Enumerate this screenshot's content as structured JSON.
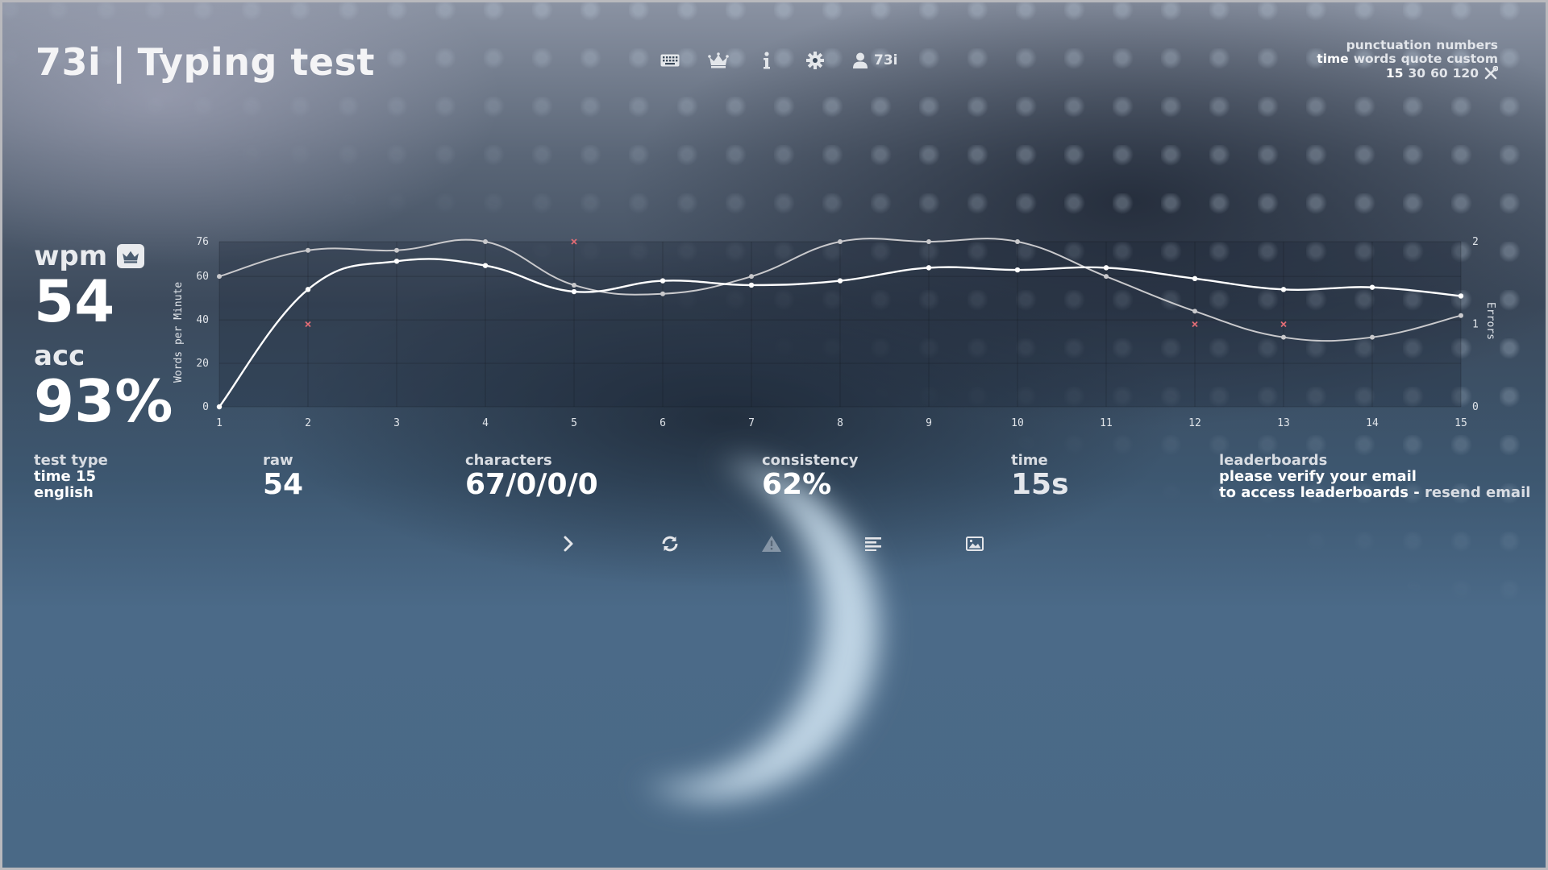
{
  "header": {
    "logo_user": "73i",
    "logo_sep": "|",
    "logo_title": "Typing test",
    "nav": [
      {
        "icon": "keyboard-icon"
      },
      {
        "icon": "crown-icon"
      },
      {
        "icon": "info-icon"
      },
      {
        "icon": "gear-icon"
      }
    ],
    "account_name": "73i"
  },
  "config": {
    "row1": [
      "punctuation",
      "numbers"
    ],
    "row2": [
      "time",
      "words",
      "quote",
      "custom"
    ],
    "row3": [
      "15",
      "30",
      "60",
      "120"
    ],
    "active_mode": "time",
    "active_time": "15",
    "tools_icon": "wrench-screwdriver-icon"
  },
  "result": {
    "wpm_label": "wpm",
    "wpm": "54",
    "acc_label": "acc",
    "acc": "93%"
  },
  "stats": {
    "test_type_label": "test type",
    "test_type_mode": "time 15",
    "test_type_lang": "english",
    "raw_label": "raw",
    "raw": "54",
    "characters_label": "characters",
    "characters": "67/0/0/0",
    "consistency_label": "consistency",
    "consistency": "62%",
    "time_label": "time",
    "time": "15s",
    "leaderboards_label": "leaderboards",
    "leaderboards_line1": "please verify your email",
    "leaderboards_line2_prefix": "to access leaderboards - ",
    "leaderboards_link": "resend email"
  },
  "actions": [
    {
      "name": "next-test-button",
      "icon": "chevron-right-icon"
    },
    {
      "name": "restart-button",
      "icon": "refresh-icon"
    },
    {
      "name": "report-button",
      "icon": "warning-icon"
    },
    {
      "name": "word-history-button",
      "icon": "list-icon"
    },
    {
      "name": "save-screenshot-button",
      "icon": "image-icon"
    }
  ],
  "colors": {
    "raw_line": "#c9c9cc",
    "wpm_line": "#ffffff",
    "error_mark": "#e06c75"
  },
  "chart_data": {
    "type": "line",
    "x": [
      1,
      2,
      3,
      4,
      5,
      6,
      7,
      8,
      9,
      10,
      11,
      12,
      13,
      14,
      15
    ],
    "xlabel": "",
    "ylabel": "Words per Minute",
    "y2label": "Errors",
    "ylim": [
      0,
      76
    ],
    "y_ticks": [
      0,
      20,
      40,
      60,
      76
    ],
    "y2lim": [
      0,
      2
    ],
    "y2_ticks": [
      0,
      1,
      2
    ],
    "series": [
      {
        "values": [
          60,
          72,
          72,
          76,
          56,
          52,
          60,
          76,
          76,
          76,
          60,
          44,
          32,
          32,
          42
        ]
      },
      {
        "values": [
          0,
          54,
          67,
          65,
          53,
          58,
          56,
          58,
          64,
          63,
          64,
          59,
          54,
          55,
          51
        ]
      },
      {
        "type": "scatter",
        "x": [
          2,
          5,
          12,
          13
        ],
        "values": [
          1,
          2,
          1,
          1
        ]
      }
    ],
    "grid": true
  }
}
